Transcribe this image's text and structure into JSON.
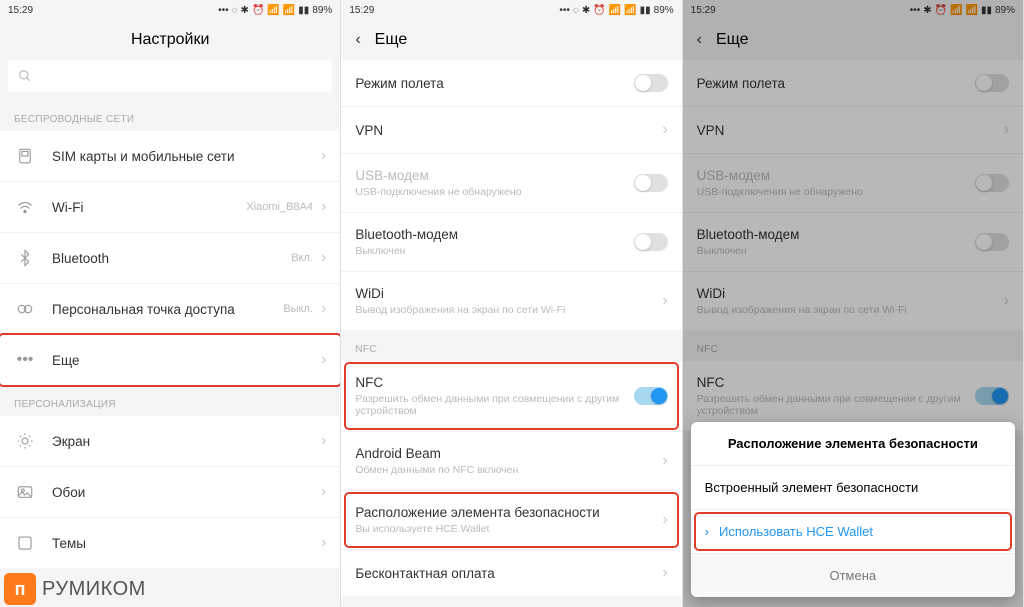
{
  "status": {
    "time": "15:29",
    "battery": "89%"
  },
  "screen1": {
    "title": "Настройки",
    "section_wireless": "БЕСПРОВОДНЫЕ СЕТИ",
    "section_personal": "ПЕРСОНАЛИЗАЦИЯ",
    "sim": "SIM карты и мобильные сети",
    "wifi": "Wi-Fi",
    "wifi_status": "Xiaomi_B8A4",
    "bt": "Bluetooth",
    "bt_status": "Вкл.",
    "hotspot": "Персональная точка доступа",
    "hotspot_status": "Выкл.",
    "more": "Еще",
    "display": "Экран",
    "wallpaper": "Обои",
    "themes": "Темы"
  },
  "screen2": {
    "title": "Еще",
    "airplane": "Режим полета",
    "vpn": "VPN",
    "usb": "USB-модем",
    "usb_sub": "USB-подключения не обнаружено",
    "btm": "Bluetooth-модем",
    "btm_sub": "Выключен",
    "widi": "WiDi",
    "widi_sub": "Вывод изображения на экран по сети Wi-Fi",
    "nfc_hdr": "NFC",
    "nfc": "NFC",
    "nfc_sub": "Разрешить обмен данными при совмещении с другим устройством",
    "beam": "Android Beam",
    "beam_sub": "Обмен данными по NFC включен",
    "secure": "Расположение элемента безопасности",
    "secure_sub": "Вы используете HCE Wallet",
    "contactless": "Бесконтактная оплата"
  },
  "sheet": {
    "title": "Расположение элемента безопасности",
    "opt1": "Встроенный элемент безопасности",
    "opt2": "Использовать HCE Wallet",
    "cancel": "Отмена"
  },
  "logo": "РУМИКОМ"
}
